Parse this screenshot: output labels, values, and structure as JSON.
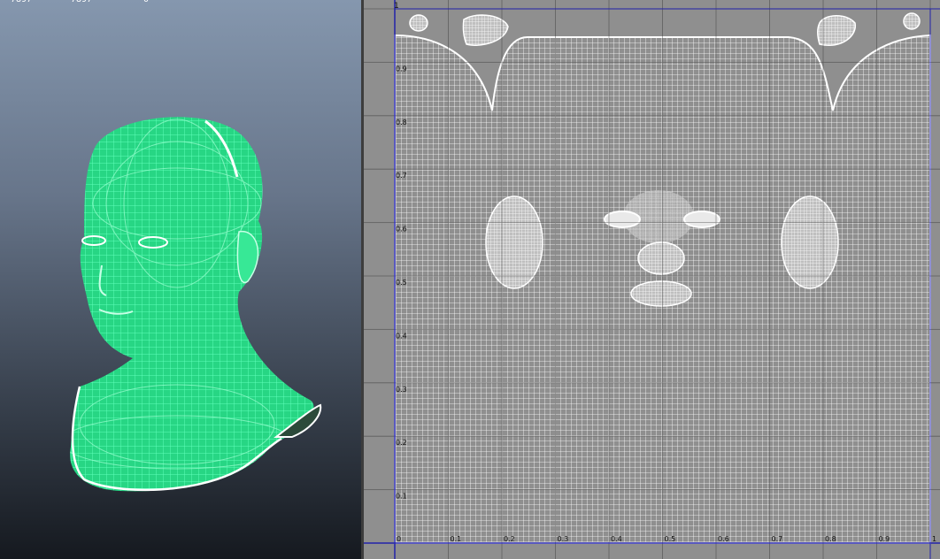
{
  "viewport": {
    "hud": [
      "7897",
      "7897",
      "0"
    ]
  },
  "uv_editor": {
    "u_ticks": [
      "0",
      "0.1",
      "0.2",
      "0.3",
      "0.4",
      "0.5",
      "0.6",
      "0.7",
      "0.8",
      "0.9",
      "1"
    ],
    "v_ticks": [
      "0.1",
      "0.2",
      "0.3",
      "0.4",
      "0.5",
      "0.6",
      "0.7",
      "0.8",
      "0.9"
    ],
    "corner_label": "1"
  },
  "colors": {
    "wire_green": "#3bffa0",
    "wire_white": "#ffffff",
    "grid_bg": "#8f8f8f",
    "axis_blue": "#2222aa"
  }
}
